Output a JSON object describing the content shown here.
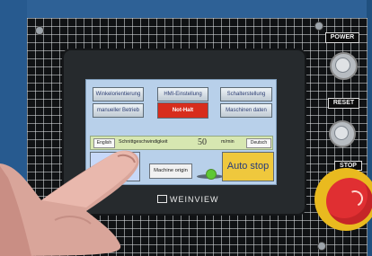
{
  "screen": {
    "buttons": [
      {
        "label": "Winkelorientierung"
      },
      {
        "label": "HMI-Einstellung"
      },
      {
        "label": "Schalterstellung"
      },
      {
        "label": "manueller Betrieb"
      },
      {
        "label": "Not-Halt"
      },
      {
        "label": "Maschinen daten"
      }
    ],
    "status_strip": {
      "left_language": "English",
      "speed_label": "Schnittgeschwindigkeit",
      "speed_value": "50",
      "speed_unit": "m/min",
      "right_language": "Deutsch"
    },
    "bottom": {
      "auto_left": "Auto",
      "machine_origin": "Machine origin",
      "auto_stop": "Auto stop"
    }
  },
  "device": {
    "brand": "WEINVIEW",
    "power_label": "POWER",
    "reset_label": "RESET",
    "stop_label": "STOP"
  },
  "colors": {
    "panel_blue": "#2d5f93",
    "screen_blue": "#b8d0ea",
    "auto_left": "#c7d8f8",
    "auto_stop": "#efc83d",
    "status_green": "#5ec834",
    "alarm_red": "#d72d1d"
  }
}
